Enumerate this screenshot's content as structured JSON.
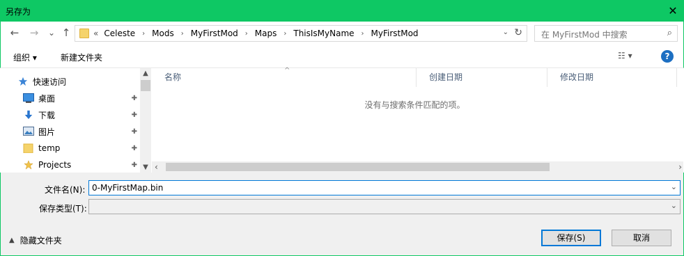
{
  "window": {
    "title": "另存为",
    "close_glyph": "✕"
  },
  "nav": {
    "back": "←",
    "forward": "→",
    "recent": "⌄",
    "up": "↑"
  },
  "address": {
    "overflow": "«",
    "crumbs": [
      "Celeste",
      "Mods",
      "MyFirstMod",
      "Maps",
      "ThisIsMyName",
      "MyFirstMod"
    ],
    "sep": "›",
    "dropdown": "⌄",
    "refresh": "↻"
  },
  "search": {
    "placeholder": "在 MyFirstMod 中搜索",
    "icon": "⌕"
  },
  "toolbar": {
    "organize": "组织 ▾",
    "new_folder": "新建文件夹",
    "views": "☷ ▾",
    "help": "?"
  },
  "sidebar": {
    "items": [
      {
        "label": "快速访问",
        "icon": "star-icon",
        "pinned": false
      },
      {
        "label": "桌面",
        "icon": "desktop-icon",
        "pinned": true
      },
      {
        "label": "下载",
        "icon": "download-icon",
        "pinned": true
      },
      {
        "label": "图片",
        "icon": "pictures-icon",
        "pinned": true
      },
      {
        "label": "temp",
        "icon": "folder-icon",
        "pinned": true
      },
      {
        "label": "Projects",
        "icon": "star-icon",
        "pinned": true
      }
    ],
    "pin_glyph": "📌"
  },
  "columns": {
    "name": "名称",
    "created": "创建日期",
    "modified": "修改日期",
    "sort_caret": "^"
  },
  "empty_message": "没有与搜索条件匹配的项。",
  "form": {
    "filename_label": "文件名(N):",
    "filename_value": "0-MyFirstMap.bin",
    "type_label": "保存类型(T):",
    "type_value": ""
  },
  "footer": {
    "hide_folders": "隐藏文件夹",
    "save": "保存(S)",
    "cancel": "取消"
  },
  "colors": {
    "titlebar": "#0ec864",
    "accent": "#0078d7"
  }
}
